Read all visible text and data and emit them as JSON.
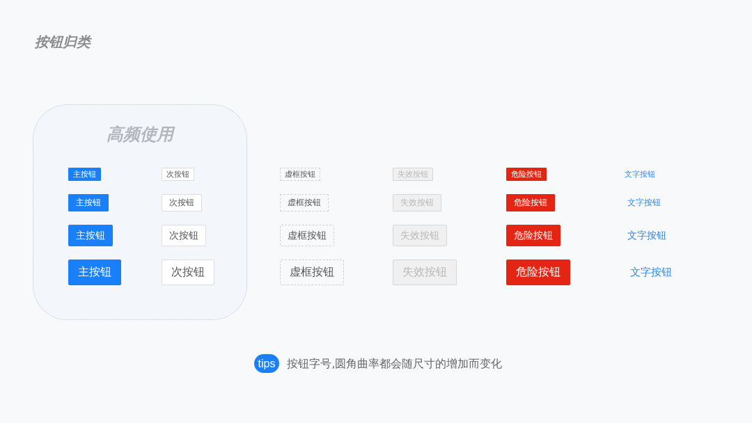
{
  "title": "按钮归类",
  "frequent_group": {
    "title": "高频使用",
    "rows": [
      {
        "buttons": [
          {
            "kind": "primary",
            "label": "主按钮"
          },
          {
            "kind": "secondary",
            "label": "次按钮"
          }
        ]
      },
      {
        "buttons": [
          {
            "kind": "primary",
            "label": "主按钮"
          },
          {
            "kind": "secondary",
            "label": "次按钮"
          }
        ]
      },
      {
        "buttons": [
          {
            "kind": "primary",
            "label": "主按钮"
          },
          {
            "kind": "secondary",
            "label": "次按钮"
          }
        ]
      },
      {
        "buttons": [
          {
            "kind": "primary",
            "label": "主按钮"
          },
          {
            "kind": "secondary",
            "label": "次按钮"
          }
        ]
      }
    ]
  },
  "other_buttons": {
    "rows": [
      {
        "buttons": [
          {
            "kind": "dashed",
            "label": "虚框按钮"
          },
          {
            "kind": "disabled",
            "label": "失效按钮"
          },
          {
            "kind": "danger",
            "label": "危险按钮"
          },
          {
            "kind": "text",
            "label": "文字按钮"
          }
        ]
      },
      {
        "buttons": [
          {
            "kind": "dashed",
            "label": "虚框按钮"
          },
          {
            "kind": "disabled",
            "label": "失效按钮"
          },
          {
            "kind": "danger",
            "label": "危险按钮"
          },
          {
            "kind": "text",
            "label": "文字按钮"
          }
        ]
      },
      {
        "buttons": [
          {
            "kind": "dashed",
            "label": "虚框按钮"
          },
          {
            "kind": "disabled",
            "label": "失效按钮"
          },
          {
            "kind": "danger",
            "label": "危险按钮"
          },
          {
            "kind": "text",
            "label": "文字按钮"
          }
        ]
      },
      {
        "buttons": [
          {
            "kind": "dashed",
            "label": "虚框按钮"
          },
          {
            "kind": "disabled",
            "label": "失效按钮"
          },
          {
            "kind": "danger",
            "label": "危险按钮"
          },
          {
            "kind": "text",
            "label": "文字按钮"
          }
        ]
      }
    ]
  },
  "tips": {
    "badge": "tips",
    "text": "按钮字号,圆角曲率都会随尺寸的增加而变化"
  }
}
